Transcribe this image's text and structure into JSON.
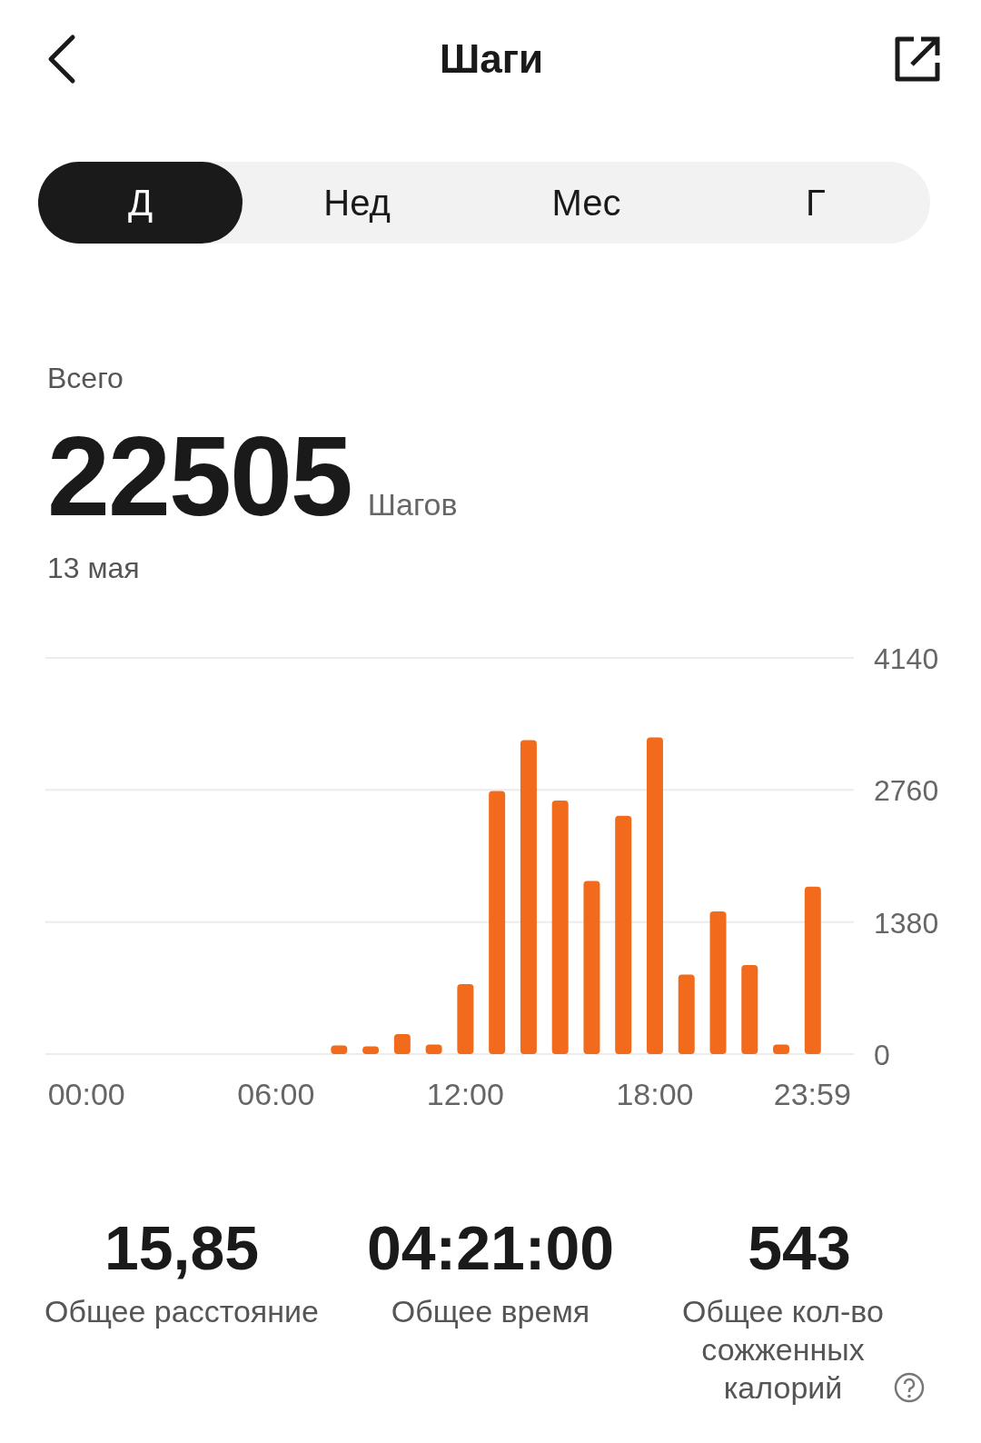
{
  "header": {
    "title": "Шаги"
  },
  "tabs": [
    {
      "label": "Д",
      "selected": true
    },
    {
      "label": "Нед",
      "selected": false
    },
    {
      "label": "Мес",
      "selected": false
    },
    {
      "label": "Г",
      "selected": false
    }
  ],
  "summary": {
    "label": "Всего",
    "value": "22505",
    "unit": "Шагов",
    "date": "13 мая"
  },
  "chart_data": {
    "type": "bar",
    "x": [
      8,
      9,
      10,
      11,
      12,
      13,
      14,
      15,
      16,
      17,
      18,
      19,
      20,
      21,
      22,
      23
    ],
    "series": [
      {
        "color": "#f26b1d",
        "values": [
          90,
          80,
          210,
          100,
          730,
          2750,
          3280,
          2650,
          1810,
          2490,
          3310,
          830,
          1490,
          930,
          100,
          1750
        ]
      }
    ],
    "xlim": [
      -1.3,
      24.3
    ],
    "ylim": [
      0,
      4140
    ],
    "yticks": [
      0,
      1380,
      2760,
      4140
    ],
    "xticks": [
      {
        "value": 0,
        "label": "00:00"
      },
      {
        "value": 6,
        "label": "06:00"
      },
      {
        "value": 12,
        "label": "12:00"
      },
      {
        "value": 18,
        "label": "18:00"
      },
      {
        "value": 23.98,
        "label": "23:59"
      }
    ]
  },
  "stats": [
    {
      "value": "15,85",
      "label": "Общее расстояние",
      "info": false
    },
    {
      "value": "04:21:00",
      "label": "Общее время",
      "info": false
    },
    {
      "value": "543",
      "label": "Общее кол-во сожженных калорий",
      "info": true
    }
  ]
}
